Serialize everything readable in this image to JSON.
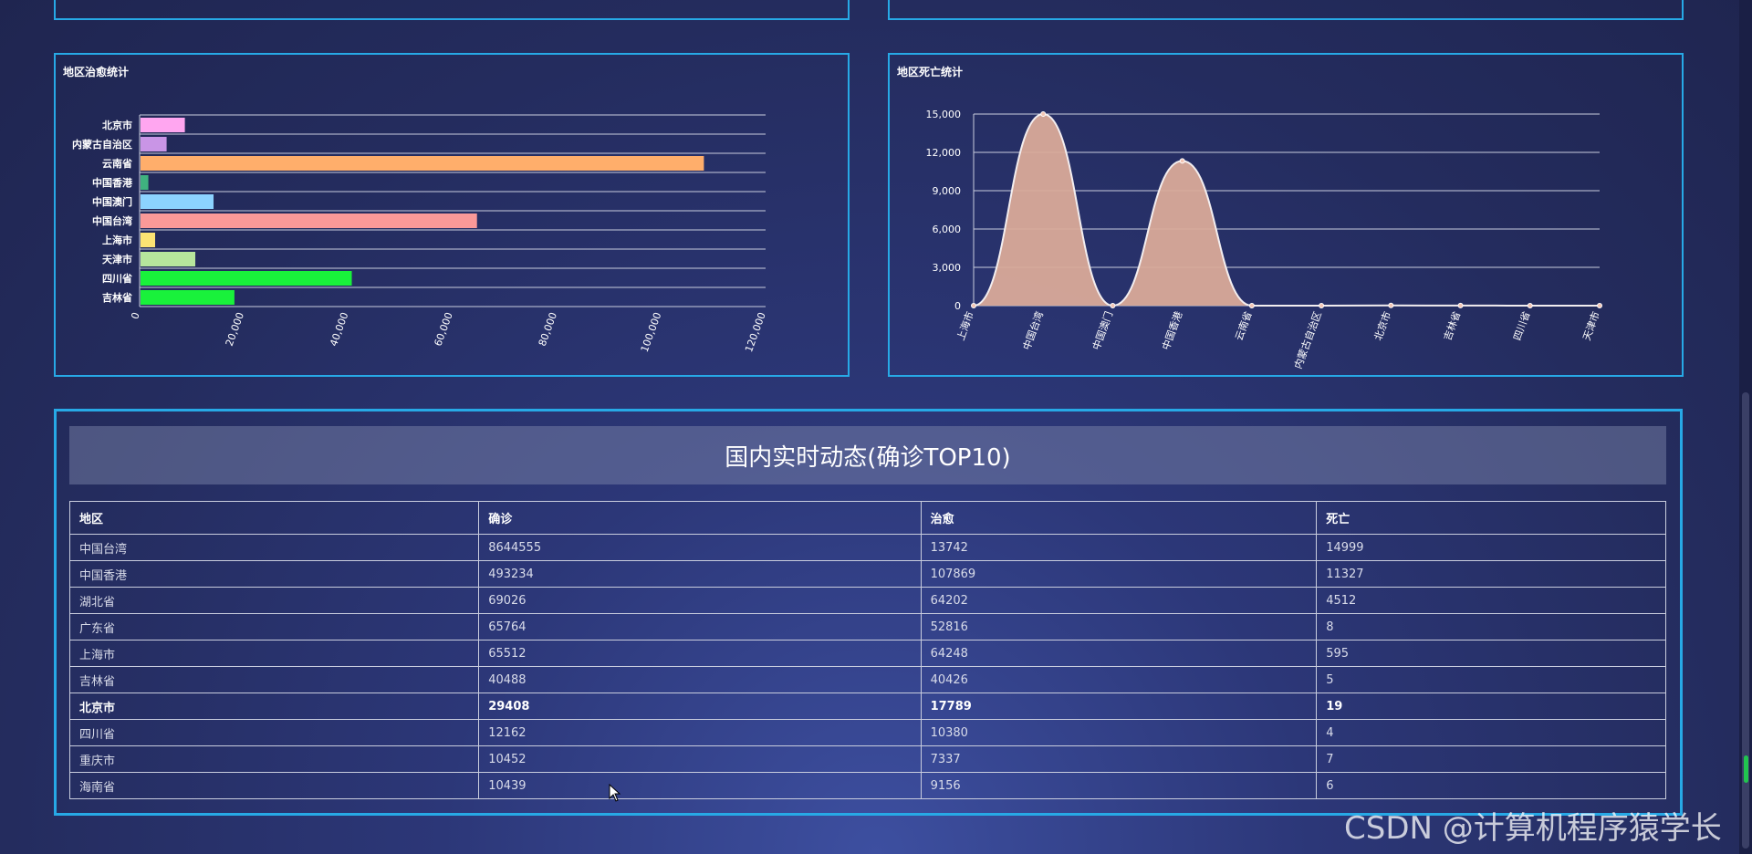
{
  "charts": {
    "cured_panel_title": "地区治愈统计",
    "death_panel_title": "地区死亡统计"
  },
  "chart_data": [
    {
      "type": "bar",
      "orientation": "horizontal",
      "title": "地区治愈统计",
      "categories": [
        "北京市",
        "内蒙古自治区",
        "云南省",
        "中国香港",
        "中国澳门",
        "中国台湾",
        "上海市",
        "天津市",
        "四川省",
        "吉林省"
      ],
      "values": [
        8500,
        5000,
        108000,
        1500,
        14000,
        64500,
        2800,
        10500,
        40500,
        18000
      ],
      "colors": [
        "#ffa6f0",
        "#c995e6",
        "#ffae6b",
        "#3fb27f",
        "#8cd3ff",
        "#fa9998",
        "#fce373",
        "#b6e69c",
        "#19f13b",
        "#19f13b"
      ],
      "xlim": [
        0,
        120000
      ],
      "xticks": [
        "0",
        "20,000",
        "40,000",
        "60,000",
        "80,000",
        "100,000",
        "120,000"
      ],
      "grid": true,
      "legend": "none"
    },
    {
      "type": "area",
      "title": "地区死亡统计",
      "categories": [
        "上海市",
        "中国台湾",
        "中国澳门",
        "中国香港",
        "云南省",
        "内蒙古自治区",
        "北京市",
        "吉林省",
        "四川省",
        "天津市"
      ],
      "values": [
        0,
        14999,
        0,
        11327,
        0,
        0,
        19,
        5,
        4,
        0
      ],
      "color": "#d9aa99",
      "ylim": [
        0,
        15000
      ],
      "yticks": [
        "0",
        "3,000",
        "6,000",
        "9,000",
        "12,000",
        "15,000"
      ],
      "grid": true,
      "legend": "none"
    }
  ],
  "table": {
    "title": "国内实时动态(确诊TOP10)",
    "headers": [
      "地区",
      "确诊",
      "治愈",
      "死亡"
    ],
    "rows": [
      [
        "中国台湾",
        "8644555",
        "13742",
        "14999"
      ],
      [
        "中国香港",
        "493234",
        "107869",
        "11327"
      ],
      [
        "湖北省",
        "69026",
        "64202",
        "4512"
      ],
      [
        "广东省",
        "65764",
        "52816",
        "8"
      ],
      [
        "上海市",
        "65512",
        "64248",
        "595"
      ],
      [
        "吉林省",
        "40488",
        "40426",
        "5"
      ],
      [
        "北京市",
        "29408",
        "17789",
        "19"
      ],
      [
        "四川省",
        "12162",
        "10380",
        "4"
      ],
      [
        "重庆市",
        "10452",
        "7337",
        "7"
      ],
      [
        "海南省",
        "10439",
        "9156",
        "6"
      ]
    ]
  },
  "watermark": "CSDN @计算机程序猿学长"
}
